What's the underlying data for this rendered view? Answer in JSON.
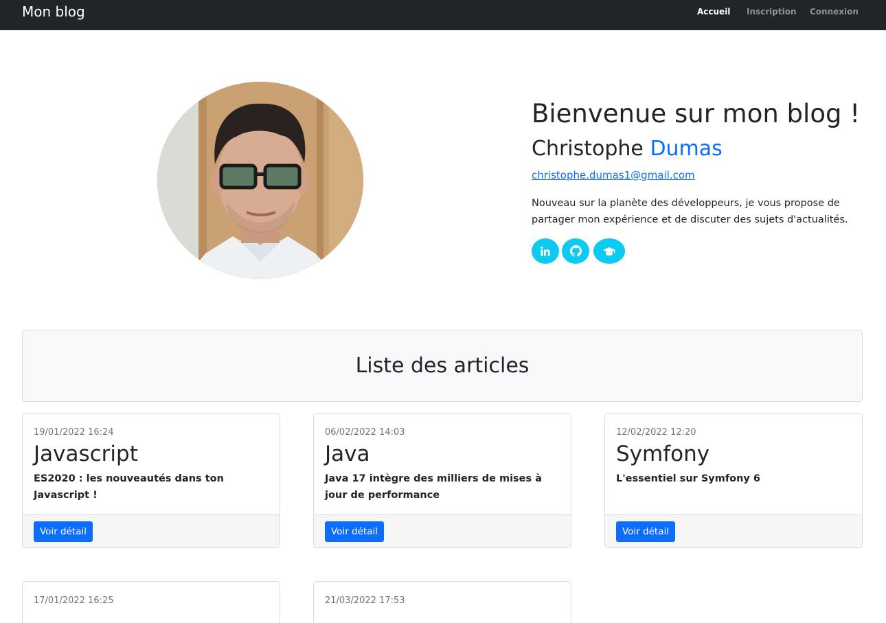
{
  "navbar": {
    "brand": "Mon blog",
    "links": [
      "Accueil",
      "Inscription",
      "Connexion"
    ]
  },
  "hero": {
    "title": "Bienvenue sur mon blog !",
    "first_name": "Christophe",
    "last_name": "Dumas",
    "email": "christophe.dumas1@gmail.com",
    "description": "Nouveau sur la planète des développeurs, je vous propose de partager mon expérience et de discuter des sujets d'actualités.",
    "socials": [
      "linkedin-icon",
      "github-icon",
      "graduation-cap-icon"
    ]
  },
  "articles": {
    "heading": "Liste des articles",
    "button_label": "Voir détail",
    "items": [
      {
        "date": "19/01/2022 16:24",
        "title": "Javascript",
        "summary": "ES2020 : les nouveautés dans ton Javascript !"
      },
      {
        "date": "06/02/2022 14:03",
        "title": "Java",
        "summary": "Java 17 intègre des milliers de mises à jour de performance"
      },
      {
        "date": "12/02/2022 12:20",
        "title": "Symfony",
        "summary": "L'essentiel sur Symfony 6"
      },
      {
        "date": "17/01/2022 16:25"
      },
      {
        "date": "21/03/2022 17:53"
      }
    ]
  },
  "colors": {
    "navbar_bg": "#212529",
    "primary": "#0d6efd",
    "info": "#0dcaf0",
    "muted": "#6c757d",
    "light_bg": "#f8f9fa"
  }
}
